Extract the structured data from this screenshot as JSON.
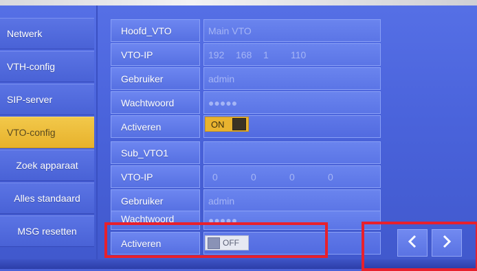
{
  "sidebar": {
    "items": [
      {
        "label": "Netwerk"
      },
      {
        "label": "VTH-config"
      },
      {
        "label": "SIP-server"
      },
      {
        "label": "VTO-config"
      },
      {
        "label": "Zoek apparaat"
      },
      {
        "label": "Alles standaard"
      },
      {
        "label": "MSG resetten"
      }
    ],
    "active": "VTO-config"
  },
  "main_vto": {
    "title_label": "Hoofd_VTO",
    "title_value": "Main VTO",
    "ip_label": "VTO-IP",
    "ip_parts": [
      "192",
      "168",
      "1",
      "110"
    ],
    "user_label": "Gebruiker",
    "user_value": "admin",
    "password_label": "Wachtwoord",
    "password_value": "●●●●●",
    "activate_label": "Activeren",
    "toggle_label": "ON"
  },
  "sub_vto": {
    "title_label": "Sub_VTO1",
    "title_value": "",
    "ip_label": "VTO-IP",
    "ip_parts": [
      "0",
      "0",
      "0",
      "0"
    ],
    "user_label": "Gebruiker",
    "user_value": "admin",
    "password_label": "Wachtwoord",
    "password_value": "●●●●●",
    "activate_label": "Activeren",
    "toggle_label": "OFF"
  },
  "nav": {
    "prev_icon": "chevron-left-icon",
    "next_icon": "chevron-right-icon"
  },
  "colors": {
    "background": "#4b62d8",
    "active_tab": "#e9b32f",
    "highlight_box": "#e8202c"
  }
}
